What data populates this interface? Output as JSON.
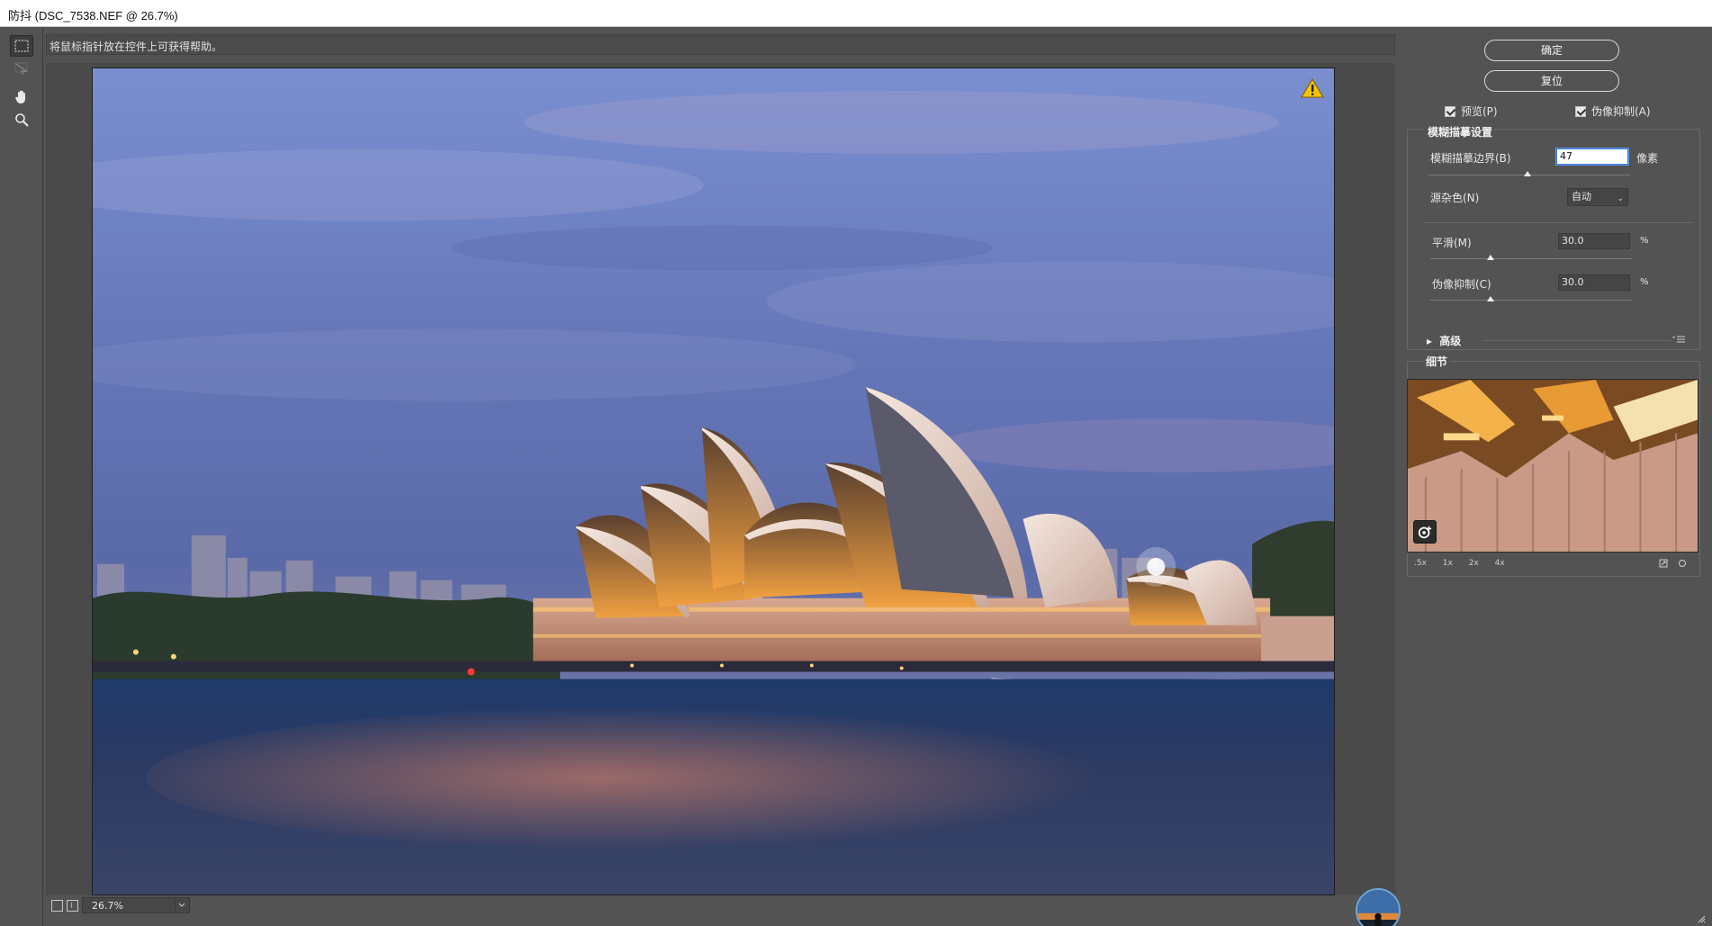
{
  "window": {
    "title": "防抖 (DSC_7538.NEF @ 26.7%)"
  },
  "help": {
    "text": "将鼠标指针放在控件上可获得帮助。"
  },
  "tools": [
    "marquee-tool",
    "blur-trace-tool",
    "hand-tool",
    "zoom-tool"
  ],
  "buttons": {
    "ok": "确定",
    "reset": "复位"
  },
  "options": {
    "preview": {
      "label": "预览(P)",
      "checked": true
    },
    "artifact_suppression": {
      "label": "伪像抑制(A)",
      "checked": true
    }
  },
  "blur_trace": {
    "title": "模糊描摹设置",
    "bounds_label": "模糊描摹边界(B)",
    "bounds_value": "47",
    "bounds_unit": "像素",
    "bounds_slider": 0.49,
    "noise_label": "源杂色(N)",
    "noise_value": "自动",
    "smoothing_label": "平滑(M)",
    "smoothing_value": "30.0",
    "smoothing_unit": "%",
    "smoothing_slider": 0.3,
    "artifact_label": "伪像抑制(C)",
    "artifact_value": "30.0",
    "artifact_unit": "%",
    "artifact_slider": 0.3
  },
  "advanced": {
    "label": "高级"
  },
  "detail": {
    "title": "细节",
    "zoom_levels": [
      ".5x",
      "1x",
      "2x",
      "4x"
    ]
  },
  "status": {
    "zoom": "26.7%"
  },
  "colors": {
    "panel": "#535353",
    "accent": "#3a7bd5",
    "warning": "#f5c400"
  }
}
